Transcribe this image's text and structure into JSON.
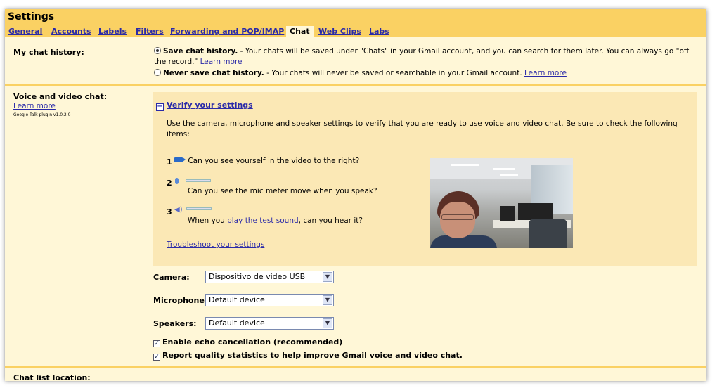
{
  "header": {
    "title": "Settings",
    "tabs": [
      {
        "label": "General"
      },
      {
        "label": "Accounts"
      },
      {
        "label": "Labels"
      },
      {
        "label": "Filters"
      },
      {
        "label": "Forwarding and POP/IMAP"
      },
      {
        "label": "Chat"
      },
      {
        "label": "Web Clips"
      },
      {
        "label": "Labs"
      }
    ],
    "active_tab": "Chat"
  },
  "chat_history": {
    "label": "My chat history:",
    "save_option": {
      "title": "Save chat history.",
      "description": " - Your chats will be saved under \"Chats\" in your Gmail account, and you can search for them later. You can always go \"off the record.\" ",
      "learn_more": "Learn more",
      "selected": true
    },
    "never_option": {
      "title": "Never save chat history.",
      "description": " - Your chats will never be saved or searchable in your Gmail account. ",
      "learn_more": "Learn more",
      "selected": false
    }
  },
  "voice_video": {
    "label": "Voice and video chat:",
    "learn_more": "Learn more",
    "plugin_version": "Google Talk plugin v1.0.2.0",
    "verify_title": "Verify your settings",
    "verify_intro": "Use the camera, microphone and speaker settings to verify that you are ready to use voice and video chat. Be sure to check the following items:",
    "checks": [
      {
        "number": "1",
        "icon": "camera-icon",
        "text": "Can you see yourself in the video to the right?"
      },
      {
        "number": "2",
        "icon": "microphone-icon",
        "text": "Can you see the mic meter move when you speak?"
      },
      {
        "number": "3",
        "icon": "speaker-icon",
        "text_before": "When you ",
        "link": "play the test sound",
        "text_after": ", can you hear it?"
      }
    ],
    "troubleshoot": "Troubleshoot your settings",
    "camera": {
      "label": "Camera:",
      "value": "Dispositivo de video USB"
    },
    "microphone": {
      "label": "Microphone:",
      "value": "Default device"
    },
    "speakers": {
      "label": "Speakers:",
      "value": "Default device"
    },
    "echo_cancellation": {
      "label": "Enable echo cancellation (recommended)",
      "checked": true
    },
    "quality_stats": {
      "label": "Report quality statistics to help improve Gmail voice and video chat.",
      "checked": true
    }
  },
  "chat_list": {
    "label": "Chat list location:"
  },
  "colors": {
    "header_bg": "#fad163",
    "page_bg": "#fff7d7",
    "panel_bg": "#fbe8b5",
    "link": "#2a2aa8"
  }
}
